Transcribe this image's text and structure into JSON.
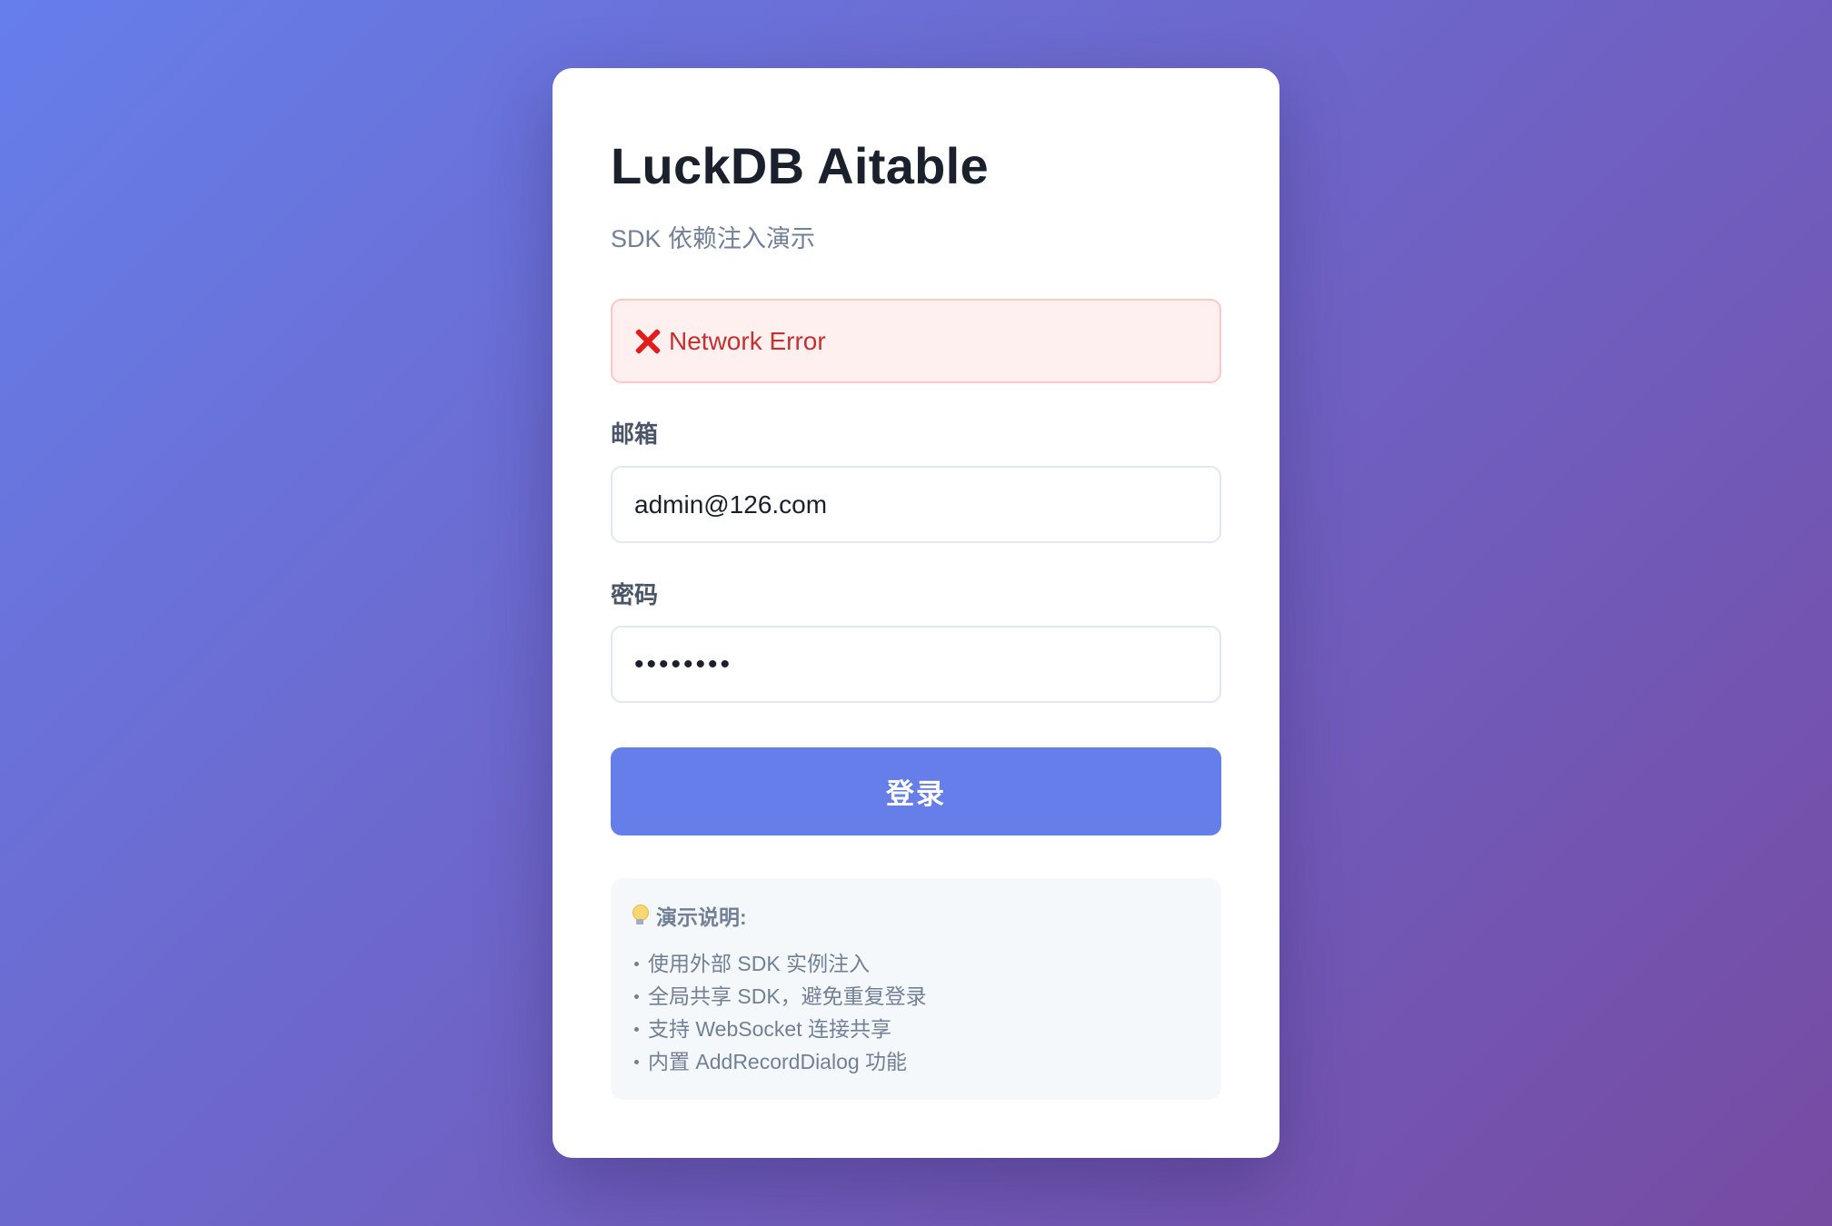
{
  "app": {
    "title": "LuckDB Aitable",
    "subtitle": "SDK 依赖注入演示"
  },
  "error": {
    "icon": "cross-mark-icon",
    "message": "Network Error",
    "color": "#c53030"
  },
  "form": {
    "email_label": "邮箱",
    "email_value": "admin@126.com",
    "password_label": "密码",
    "password_value": "••••••••",
    "submit_label": "登录"
  },
  "info": {
    "icon": "lightbulb-icon",
    "heading": "演示说明:",
    "items": [
      "使用外部 SDK 实例注入",
      "全局共享 SDK，避免重复登录",
      "支持 WebSocket 连接共享",
      "内置 AddRecordDialog 功能"
    ]
  },
  "colors": {
    "accent": "#667eea",
    "background_start": "#667eea",
    "background_end": "#764ba2"
  }
}
